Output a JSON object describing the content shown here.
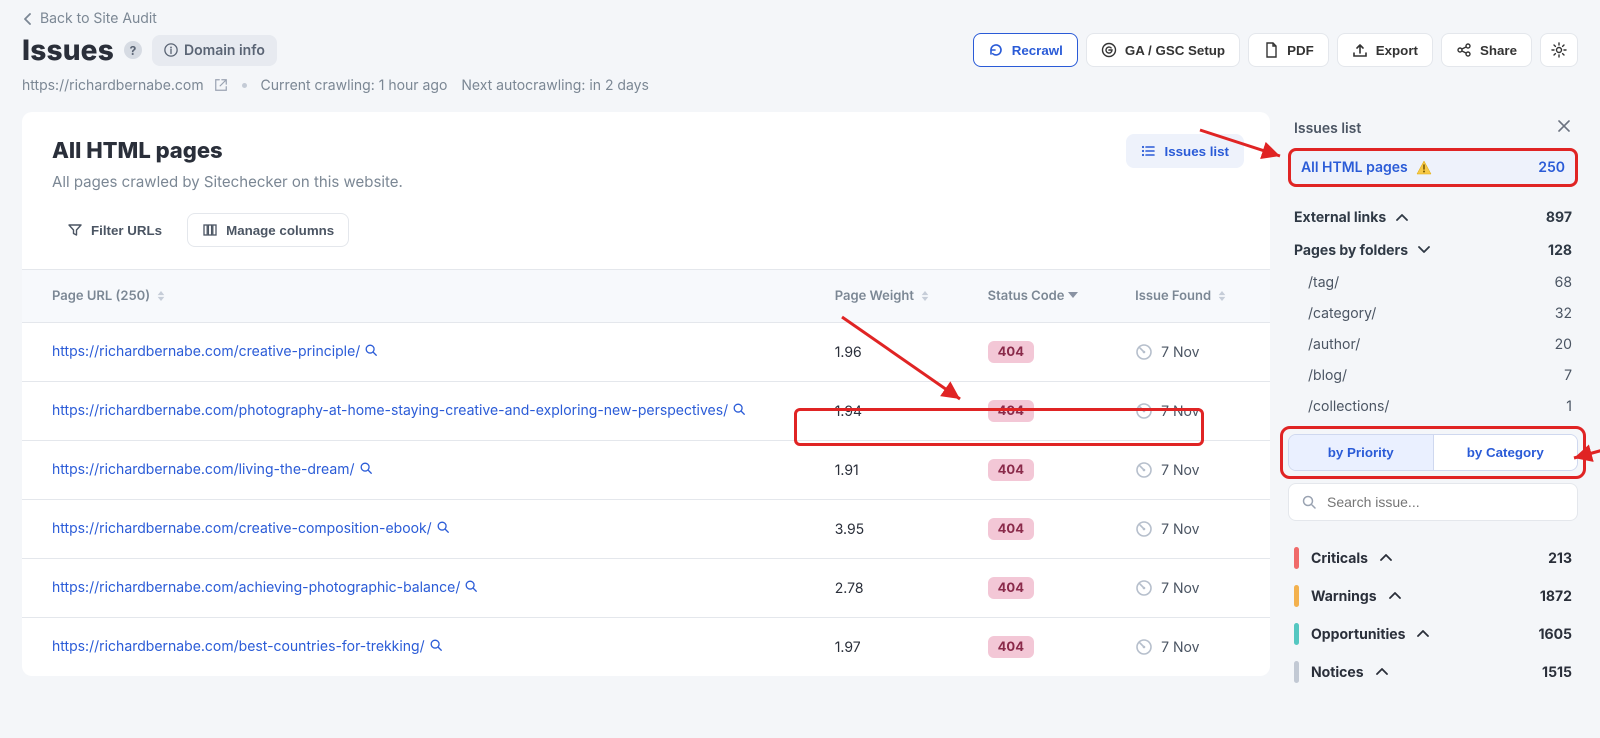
{
  "back_label": "Back to Site Audit",
  "page_title": "Issues",
  "domain_info_label": "Domain info",
  "site_url": "https://richardbernabe.com",
  "crawl_status": "Current crawling: 1 hour ago",
  "next_crawl": "Next autocrawling: in 2 days",
  "actions": {
    "recrawl": "Recrawl",
    "ga_gsc": "GA / GSC Setup",
    "pdf": "PDF",
    "export": "Export",
    "share": "Share"
  },
  "main": {
    "title": "All HTML pages",
    "subtitle": "All pages crawled by Sitechecker on this website.",
    "issues_list_btn": "Issues list",
    "filter_btn": "Filter URLs",
    "columns_btn": "Manage columns",
    "columns": {
      "url": "Page URL (250)",
      "weight": "Page Weight",
      "status": "Status Code",
      "issue": "Issue Found"
    },
    "rows": [
      {
        "url": "https://richardbernabe.com/creative-principle/",
        "weight": "1.96",
        "status": "404",
        "issue": "7 Nov"
      },
      {
        "url": "https://richardbernabe.com/photography-at-home-staying-creative-and-exploring-new-perspectives/",
        "weight": "1.94",
        "status": "404",
        "issue": "7 Nov"
      },
      {
        "url": "https://richardbernabe.com/living-the-dream/",
        "weight": "1.91",
        "status": "404",
        "issue": "7 Nov"
      },
      {
        "url": "https://richardbernabe.com/creative-composition-ebook/",
        "weight": "3.95",
        "status": "404",
        "issue": "7 Nov"
      },
      {
        "url": "https://richardbernabe.com/achieving-photographic-balance/",
        "weight": "2.78",
        "status": "404",
        "issue": "7 Nov"
      },
      {
        "url": "https://richardbernabe.com/best-countries-for-trekking/",
        "weight": "1.97",
        "status": "404",
        "issue": "7 Nov"
      }
    ]
  },
  "side": {
    "header": "Issues list",
    "all_html": {
      "label": "All HTML pages",
      "count": "250"
    },
    "groups": [
      {
        "label": "External links",
        "count": "897",
        "open": true,
        "items": []
      },
      {
        "label": "Pages by folders",
        "count": "128",
        "open": false,
        "items": [
          {
            "label": "/tag/",
            "count": "68"
          },
          {
            "label": "/category/",
            "count": "32"
          },
          {
            "label": "/author/",
            "count": "20"
          },
          {
            "label": "/blog/",
            "count": "7"
          },
          {
            "label": "/collections/",
            "count": "1"
          }
        ]
      }
    ],
    "toggle": {
      "priority": "by Priority",
      "category": "by Category"
    },
    "search_placeholder": "Search issue...",
    "severity": [
      {
        "label": "Criticals",
        "count": "213",
        "cls": "red"
      },
      {
        "label": "Warnings",
        "count": "1872",
        "cls": "orange"
      },
      {
        "label": "Opportunities",
        "count": "1605",
        "cls": "teal"
      },
      {
        "label": "Notices",
        "count": "1515",
        "cls": "gray"
      }
    ]
  }
}
